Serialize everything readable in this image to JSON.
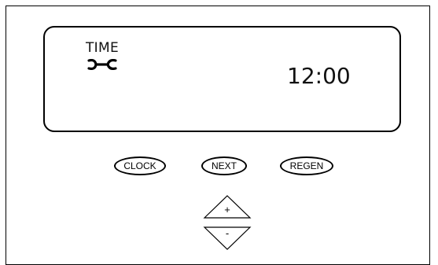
{
  "display": {
    "mode_label": "TIME",
    "service_icon": "wrench-icon",
    "value": "12:00"
  },
  "buttons": {
    "clock": "CLOCK",
    "next": "NEXT",
    "regen": "REGEN",
    "up": "+",
    "down": "-"
  }
}
